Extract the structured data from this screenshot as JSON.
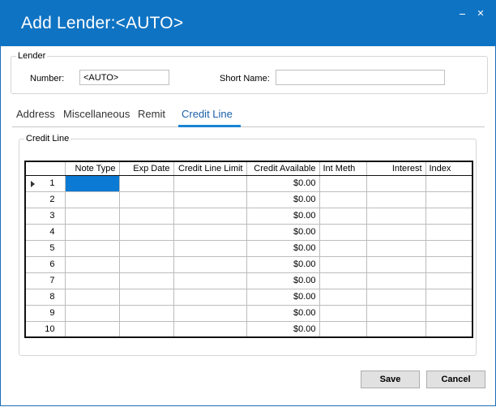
{
  "window": {
    "title": "Add Lender:<AUTO>",
    "minimize_glyph": "_",
    "close_glyph": "✕"
  },
  "lender": {
    "legend": "Lender",
    "number_label": "Number:",
    "number_value": "<AUTO>",
    "short_name_label": "Short Name:",
    "short_name_value": ""
  },
  "tabs": [
    {
      "label": "Address",
      "active": false
    },
    {
      "label": "Miscellaneous",
      "active": false
    },
    {
      "label": "Remit",
      "active": false
    },
    {
      "label": "Credit Line",
      "active": true
    }
  ],
  "credit_line": {
    "legend": "Credit Line",
    "columns": [
      "Note Type",
      "Exp Date",
      "Credit Line Limit",
      "Credit Available",
      "Int Meth",
      "Interest",
      "Index"
    ],
    "rows": [
      {
        "num": "1",
        "note_type": "",
        "exp_date": "",
        "limit": "",
        "available": "$0.00",
        "int_meth": "",
        "interest": "",
        "index": ""
      },
      {
        "num": "2",
        "note_type": "",
        "exp_date": "",
        "limit": "",
        "available": "$0.00",
        "int_meth": "",
        "interest": "",
        "index": ""
      },
      {
        "num": "3",
        "note_type": "",
        "exp_date": "",
        "limit": "",
        "available": "$0.00",
        "int_meth": "",
        "interest": "",
        "index": ""
      },
      {
        "num": "4",
        "note_type": "",
        "exp_date": "",
        "limit": "",
        "available": "$0.00",
        "int_meth": "",
        "interest": "",
        "index": ""
      },
      {
        "num": "5",
        "note_type": "",
        "exp_date": "",
        "limit": "",
        "available": "$0.00",
        "int_meth": "",
        "interest": "",
        "index": ""
      },
      {
        "num": "6",
        "note_type": "",
        "exp_date": "",
        "limit": "",
        "available": "$0.00",
        "int_meth": "",
        "interest": "",
        "index": ""
      },
      {
        "num": "7",
        "note_type": "",
        "exp_date": "",
        "limit": "",
        "available": "$0.00",
        "int_meth": "",
        "interest": "",
        "index": ""
      },
      {
        "num": "8",
        "note_type": "",
        "exp_date": "",
        "limit": "",
        "available": "$0.00",
        "int_meth": "",
        "interest": "",
        "index": ""
      },
      {
        "num": "9",
        "note_type": "",
        "exp_date": "",
        "limit": "",
        "available": "$0.00",
        "int_meth": "",
        "interest": "",
        "index": ""
      },
      {
        "num": "10",
        "note_type": "",
        "exp_date": "",
        "limit": "",
        "available": "$0.00",
        "int_meth": "",
        "interest": "",
        "index": ""
      }
    ]
  },
  "buttons": {
    "save": "Save",
    "cancel": "Cancel"
  },
  "colors": {
    "titlebar": "#0f73c3",
    "selected_cell": "#0b7ad4",
    "active_tab_underline": "#1a84d6"
  }
}
